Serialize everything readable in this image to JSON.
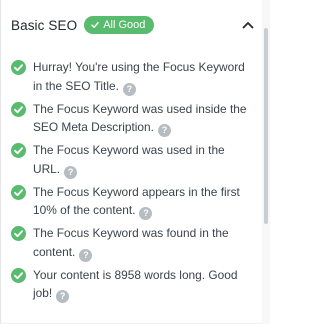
{
  "section": {
    "title": "Basic SEO",
    "badge": "All Good"
  },
  "checks": [
    {
      "text": "Hurray! You're using the Focus Keyword in the SEO Title.",
      "status": "pass"
    },
    {
      "text": "The Focus Keyword was used inside the SEO Meta Description.",
      "status": "pass"
    },
    {
      "text": "The Focus Keyword was used in the URL.",
      "status": "pass"
    },
    {
      "text": "The Focus Keyword appears in the first 10% of the content.",
      "status": "pass"
    },
    {
      "text": "The Focus Keyword was found in the content.",
      "status": "pass"
    },
    {
      "text": "Your content is 8958 words long. Good job!",
      "status": "pass"
    }
  ],
  "help_glyph": "?",
  "colors": {
    "pass": "#58bb6d",
    "help": "#b5bcc2"
  },
  "icons": {
    "status": "check-circle-icon",
    "toggle": "chevron-up-icon",
    "help": "help-icon"
  }
}
